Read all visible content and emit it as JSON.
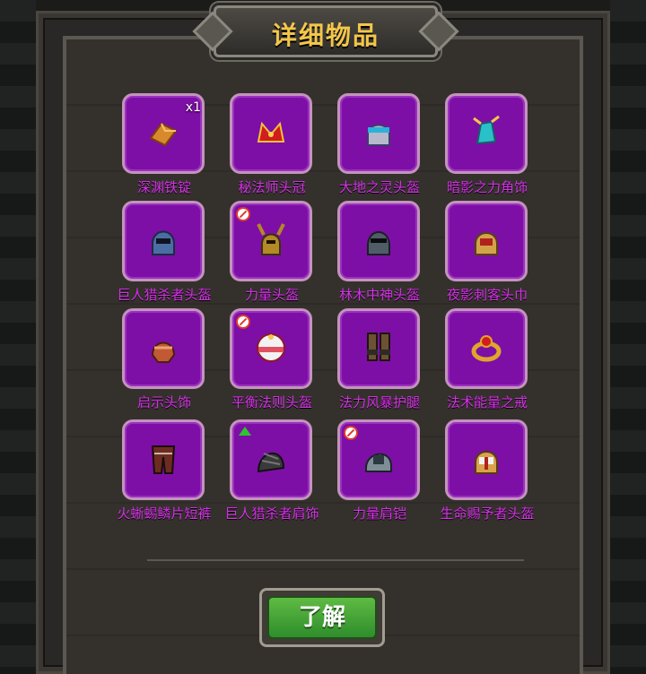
{
  "title": "详细物品",
  "items": [
    {
      "name": "深渊铁锭",
      "qty": "x1",
      "marker": "none",
      "icon": "ingot-icon",
      "color": "#d8892b"
    },
    {
      "name": "秘法师头冠",
      "marker": "none",
      "icon": "crown-icon",
      "color": "#d11d1d"
    },
    {
      "name": "大地之灵头盔",
      "marker": "none",
      "icon": "helmet-icon",
      "color": "#b7b8cc"
    },
    {
      "name": "暗影之力角饰",
      "marker": "none",
      "icon": "horn-ornament-icon",
      "color": "#29c1c7"
    },
    {
      "name": "巨人猎杀者头盔",
      "marker": "none",
      "icon": "helmet-icon",
      "color": "#4a6ea4"
    },
    {
      "name": "力量头盔",
      "marker": "ban",
      "icon": "horned-helmet-icon",
      "color": "#b38a25"
    },
    {
      "name": "林木中神头盔",
      "marker": "none",
      "icon": "helmet-icon",
      "color": "#4f5d68"
    },
    {
      "name": "夜影刺客头巾",
      "marker": "none",
      "icon": "helmet-icon",
      "color": "#d2a44a"
    },
    {
      "name": "启示头饰",
      "marker": "none",
      "icon": "headpiece-icon",
      "color": "#c15a34"
    },
    {
      "name": "平衡法则头盔",
      "marker": "ban",
      "icon": "orb-helmet-icon",
      "color": "#e05062"
    },
    {
      "name": "法力风暴护腿",
      "marker": "none",
      "icon": "greaves-icon",
      "color": "#6b5233"
    },
    {
      "name": "法术能量之戒",
      "marker": "none",
      "icon": "ring-icon",
      "color": "#e0a52b"
    },
    {
      "name": "火蜥蜴鳞片短裤",
      "marker": "none",
      "icon": "shorts-icon",
      "color": "#6d2c22"
    },
    {
      "name": "巨人猎杀者肩饰",
      "marker": "upgrade",
      "icon": "pauldron-icon",
      "color": "#3a3a3a"
    },
    {
      "name": "力量肩铠",
      "marker": "ban",
      "icon": "shoulder-armor-icon",
      "color": "#7f8d97"
    },
    {
      "name": "生命赐予者头盔",
      "marker": "none",
      "icon": "helmet-icon",
      "color": "#d9a34e"
    }
  ],
  "buttons": {
    "ok": "了解"
  }
}
